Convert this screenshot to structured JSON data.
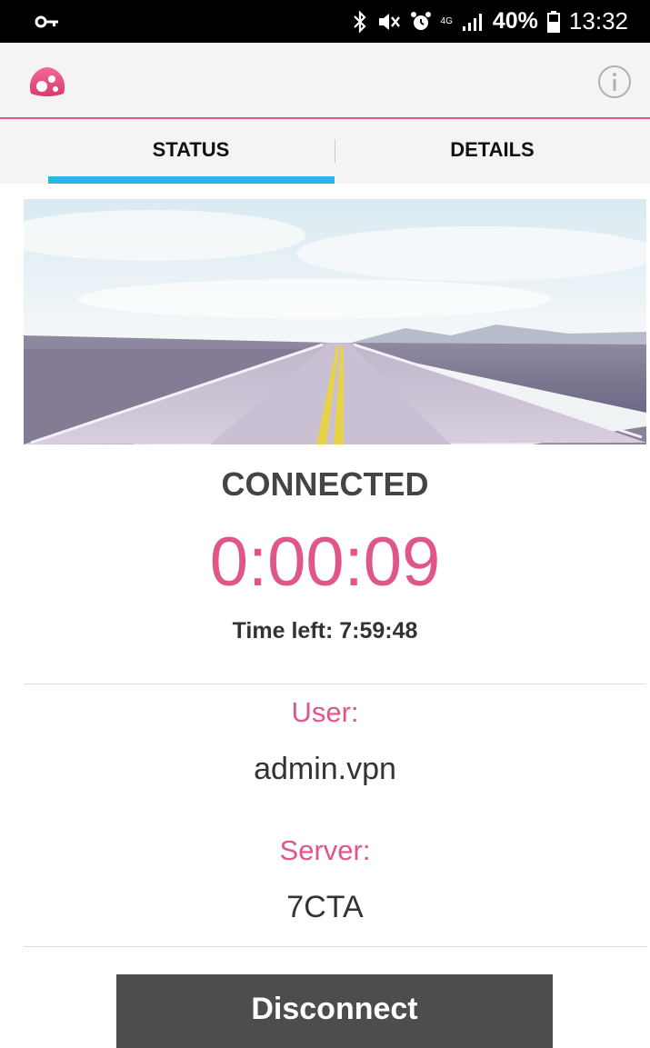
{
  "status_bar": {
    "signal_type": "4G",
    "battery_percent": "40%",
    "time": "13:32"
  },
  "tabs": [
    {
      "label": "STATUS"
    },
    {
      "label": "DETAILS"
    }
  ],
  "status": {
    "state": "CONNECTED",
    "elapsed": "0:00:09",
    "time_left": "Time left: 7:59:48"
  },
  "account": {
    "user_label": "User:",
    "user_value": "admin.vpn",
    "server_label": "Server:",
    "server_value": "7CTA"
  },
  "actions": {
    "disconnect_label": "Disconnect"
  },
  "colors": {
    "accent_pink": "#e0558a",
    "tab_indicator": "#2db3e6",
    "button_bg": "#4d4d4d"
  },
  "icons": {
    "status_bar": [
      "vpn-key-icon",
      "bluetooth-icon",
      "mute-icon",
      "alarm-icon",
      "signal-icon",
      "battery-icon"
    ],
    "app_bar": [
      "app-logo-icon",
      "info-icon"
    ]
  }
}
